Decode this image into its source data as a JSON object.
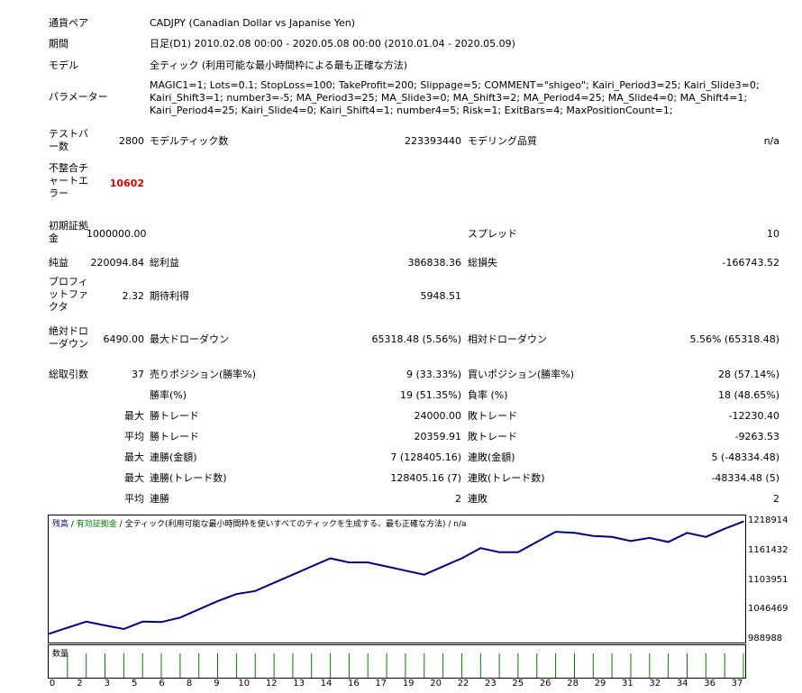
{
  "header": [
    {
      "label": "通貨ペア",
      "value": "CADJPY (Canadian Dollar vs Japanise Yen)"
    },
    {
      "label": "期間",
      "value": "日足(D1) 2010.02.08 00:00 - 2020.05.08 00:00 (2010.01.04 - 2020.05.09)"
    },
    {
      "label": "モデル",
      "value": "全ティック (利用可能な最小時間枠による最も正確な方法)"
    },
    {
      "label": "パラメーター",
      "value": "MAGIC1=1; Lots=0.1; StopLoss=100; TakeProfit=200; Slippage=5; COMMENT=\"shigeo\"; Kairi_Period3=25; Kairi_Slide3=0; Kairi_Shift3=1; number3=-5; MA_Period3=25; MA_Slide3=0; MA_Shift3=2; MA_Period4=25; MA_Slide4=0; MA_Shift4=1; Kairi_Period4=25; Kairi_Slide4=0; Kairi_Shift4=1; number4=5; Risk=1; ExitBars=4; MaxPositionCount=1;"
    }
  ],
  "stats": {
    "bars_label": "テストバー数",
    "bars": "2800",
    "ticks_label": "モデルティック数",
    "ticks": "223393440",
    "quality_label": "モデリング品質",
    "quality": "n/a",
    "mismatch_label": "不整合チャートエラー",
    "mismatch": "10602",
    "deposit_label": "初期証拠金",
    "deposit": "1000000.00",
    "spread_label": "スプレッド",
    "spread": "10",
    "net_label": "純益",
    "net": "220094.84",
    "gross_profit_label": "総利益",
    "gross_profit": "386838.36",
    "gross_loss_label": "総損失",
    "gross_loss": "-166743.52",
    "pf_label": "プロフィットファクタ",
    "pf": "2.32",
    "expected_label": "期待利得",
    "expected": "5948.51",
    "abs_dd_label": "絶対ドローダウン",
    "abs_dd": "6490.00",
    "max_dd_label": "最大ドローダウン",
    "max_dd": "65318.48 (5.56%)",
    "rel_dd_label": "相対ドローダウン",
    "rel_dd": "5.56% (65318.48)",
    "trades_label": "総取引数",
    "trades": "37",
    "short_label": "売りポジション(勝率%)",
    "short": "9 (33.33%)",
    "long_label": "買いポジション(勝率%)",
    "long": "28 (57.14%)",
    "win_label": "勝率(%)",
    "win": "19 (51.35%)",
    "loss_label": "負率 (%)",
    "loss": "18 (48.65%)"
  },
  "groups": {
    "max": "最大",
    "avg": "平均",
    "rows": [
      {
        "g": "最大",
        "l1": "勝トレード",
        "v1": "24000.00",
        "l2": "敗トレード",
        "v2": "-12230.40"
      },
      {
        "g": "平均",
        "l1": "勝トレード",
        "v1": "20359.91",
        "l2": "敗トレード",
        "v2": "-9263.53"
      },
      {
        "g": "最大",
        "l1": "連勝(金額)",
        "v1": "7 (128405.16)",
        "l2": "連敗(金額)",
        "v2": "5 (-48334.48)"
      },
      {
        "g": "最大",
        "l1": "連勝(トレード数)",
        "v1": "128405.16 (7)",
        "l2": "連敗(トレード数)",
        "v2": "-48334.48 (5)"
      },
      {
        "g": "平均",
        "l1": "連勝",
        "v1": "2",
        "l2": "連敗",
        "v2": "2"
      }
    ]
  },
  "chart_data": {
    "type": "line",
    "legend": {
      "balance": "残高",
      "sep1": " / ",
      "equity": "有効証拠金",
      "sep2": " / ",
      "model": "全ティック(利用可能な最小時間枠を使いすべてのティックを生成する、最も正確な方法)",
      "sep3": " / ",
      "quality": "n/a"
    },
    "y_ticks": [
      "1218914",
      "1161432",
      "1103951",
      "1046469",
      "988988"
    ],
    "y_tick_values": [
      1218914,
      1161432,
      1103951,
      1046469,
      988988
    ],
    "ylim": [
      983000,
      1232000
    ],
    "x_ticks": [
      "0",
      "2",
      "3",
      "5",
      "6",
      "8",
      "9",
      "10",
      "12",
      "13",
      "14",
      "16",
      "17",
      "19",
      "20",
      "22",
      "23",
      "25",
      "26",
      "28",
      "29",
      "31",
      "32",
      "34",
      "36",
      "37"
    ],
    "x": [
      0,
      1,
      2,
      3,
      4,
      5,
      6,
      7,
      8,
      9,
      10,
      11,
      12,
      13,
      14,
      15,
      16,
      17,
      18,
      19,
      20,
      21,
      22,
      23,
      24,
      25,
      26,
      27,
      28,
      29,
      30,
      31,
      32,
      33,
      34,
      35,
      36,
      37
    ],
    "values": [
      1000000,
      1012000,
      1024000,
      1016500,
      1009500,
      1024000,
      1023000,
      1032000,
      1048000,
      1064000,
      1078000,
      1084000,
      1100000,
      1116000,
      1132000,
      1148000,
      1140000,
      1140000,
      1132000,
      1124000,
      1116000,
      1132000,
      1148000,
      1168000,
      1160000,
      1160000,
      1180000,
      1200000,
      1198000,
      1192000,
      1190000,
      1182000,
      1188000,
      1180000,
      1198000,
      1190000,
      1206000,
      1220094
    ],
    "volume_title": "数量",
    "grid": false
  }
}
